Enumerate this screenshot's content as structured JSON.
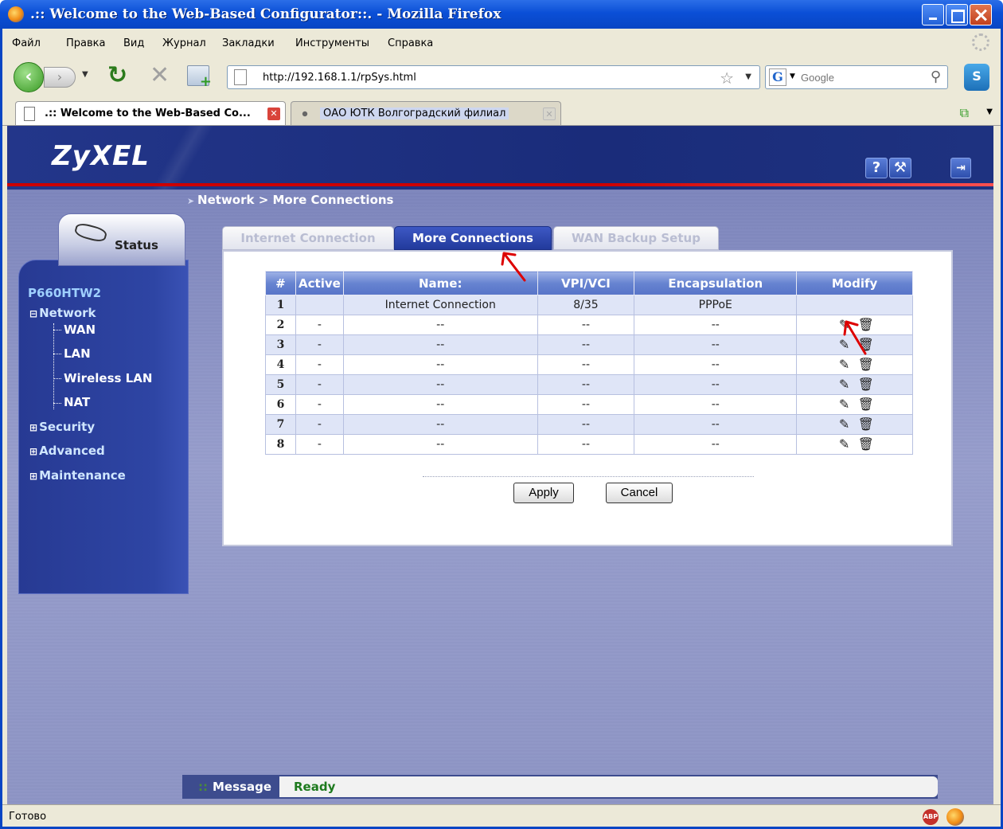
{
  "window": {
    "title": ".:: Welcome to the Web-Based Configurator::. - Mozilla Firefox"
  },
  "menu": [
    "Файл",
    "Правка",
    "Вид",
    "Журнал",
    "Закладки",
    "Инструменты",
    "Справка"
  ],
  "toolbar": {
    "url": "http://192.168.1.1/rpSys.html",
    "search_placeholder": "Google",
    "search_engine_icon": "G"
  },
  "browser_tabs": [
    {
      "label": ".:: Welcome to the Web-Based Co...",
      "active": true
    },
    {
      "label": "ОАО ЮТК Волгоградский филиал",
      "active": false
    }
  ],
  "header": {
    "logo": "ZyXEL",
    "help_label": "?",
    "wizard_label": "⚒",
    "logout_label": "⇥"
  },
  "breadcrumb": "Network > More Connections",
  "sidebar": {
    "status_label": "Status",
    "model": "P660HTW2",
    "categories": [
      {
        "label": "Network",
        "expanded": true,
        "children": [
          "WAN",
          "LAN",
          "Wireless LAN",
          "NAT"
        ]
      },
      {
        "label": "Security",
        "expanded": false
      },
      {
        "label": "Advanced",
        "expanded": false
      },
      {
        "label": "Maintenance",
        "expanded": false
      }
    ]
  },
  "tabs": [
    {
      "label": "Internet Connection",
      "active": false
    },
    {
      "label": "More Connections",
      "active": true
    },
    {
      "label": "WAN Backup Setup",
      "active": false
    }
  ],
  "table": {
    "columns": [
      "#",
      "Active",
      "Name:",
      "VPI/VCI",
      "Encapsulation",
      "Modify"
    ],
    "rows": [
      {
        "num": "1",
        "active": "",
        "name": "Internet Connection",
        "vpivci": "8/35",
        "encap": "PPPoE",
        "editable": false
      },
      {
        "num": "2",
        "active": "-",
        "name": "--",
        "vpivci": "--",
        "encap": "--",
        "editable": true
      },
      {
        "num": "3",
        "active": "-",
        "name": "--",
        "vpivci": "--",
        "encap": "--",
        "editable": true
      },
      {
        "num": "4",
        "active": "-",
        "name": "--",
        "vpivci": "--",
        "encap": "--",
        "editable": true
      },
      {
        "num": "5",
        "active": "-",
        "name": "--",
        "vpivci": "--",
        "encap": "--",
        "editable": true
      },
      {
        "num": "6",
        "active": "-",
        "name": "--",
        "vpivci": "--",
        "encap": "--",
        "editable": true
      },
      {
        "num": "7",
        "active": "-",
        "name": "--",
        "vpivci": "--",
        "encap": "--",
        "editable": true
      },
      {
        "num": "8",
        "active": "-",
        "name": "--",
        "vpivci": "--",
        "encap": "--",
        "editable": true
      }
    ]
  },
  "buttons": {
    "apply": "Apply",
    "cancel": "Cancel"
  },
  "message": {
    "label": "Message",
    "value": "Ready"
  },
  "statusbar": {
    "text": "Готово",
    "adblock": "ABP"
  },
  "colors": {
    "header_bg": "#1a2c7a",
    "accent_red": "#cc0000",
    "active_tab": "#223a9c",
    "message_ok": "#1e7a1e"
  }
}
